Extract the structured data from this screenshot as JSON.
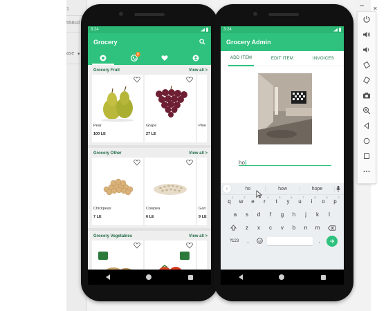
{
  "background": {
    "fragment_1": "556cd",
    "fragment_2": "ase",
    "fragment_3": "1"
  },
  "toolbar": {
    "items": [
      "power-icon",
      "volume-up-icon",
      "volume-down-icon",
      "rotate-left-icon",
      "rotate-right-icon",
      "camera-icon",
      "zoom-icon",
      "back-icon",
      "home-icon",
      "overview-icon",
      "more-icon"
    ],
    "close_label": "✕"
  },
  "phone_left": {
    "status_time": "3:24",
    "app_title": "Grocery",
    "cart_badge": "0",
    "sections": [
      {
        "title": "Grocery Fruit",
        "view_all": "View all >",
        "items": [
          {
            "name": "Pear",
            "price": "100 LE"
          },
          {
            "name": "Grape",
            "price": "27 LE"
          },
          {
            "name": "Pine",
            "price": ""
          }
        ]
      },
      {
        "title": "Grocery Other",
        "view_all": "View all >",
        "items": [
          {
            "name": "Chickpeas",
            "price": "7 LE"
          },
          {
            "name": "Cowpea",
            "price": "6 LE"
          },
          {
            "name": "Garl",
            "price": "9 LE"
          }
        ]
      },
      {
        "title": "Grocery Vegetables",
        "view_all": "View all >",
        "items": [
          {
            "name": "",
            "price": ""
          },
          {
            "name": "",
            "price": ""
          },
          {
            "name": "",
            "price": ""
          }
        ]
      }
    ]
  },
  "phone_right": {
    "status_time": "3:24",
    "app_title": "Grocery Admin",
    "tabs": [
      "ADD ITEM",
      "EDIT ITEM",
      "INVOICES"
    ],
    "input_value": "ho",
    "suggestions": [
      "ho",
      "how",
      "hope"
    ],
    "keyboard": {
      "row1": [
        "q",
        "w",
        "e",
        "r",
        "t",
        "y",
        "u",
        "i",
        "o",
        "p"
      ],
      "row1_sub": [
        "1",
        "2",
        "3",
        "4",
        "5",
        "6",
        "7",
        "8",
        "9",
        "0"
      ],
      "row2": [
        "a",
        "s",
        "d",
        "f",
        "g",
        "h",
        "j",
        "k",
        "l"
      ],
      "row3": [
        "z",
        "x",
        "c",
        "v",
        "b",
        "n",
        "m"
      ],
      "symbols_key": "?123",
      "comma_key": ",",
      "period_key": "."
    }
  },
  "colors": {
    "primary": "#2ec27e",
    "dark_green": "#1f6b45",
    "badge": "#f5841f"
  }
}
